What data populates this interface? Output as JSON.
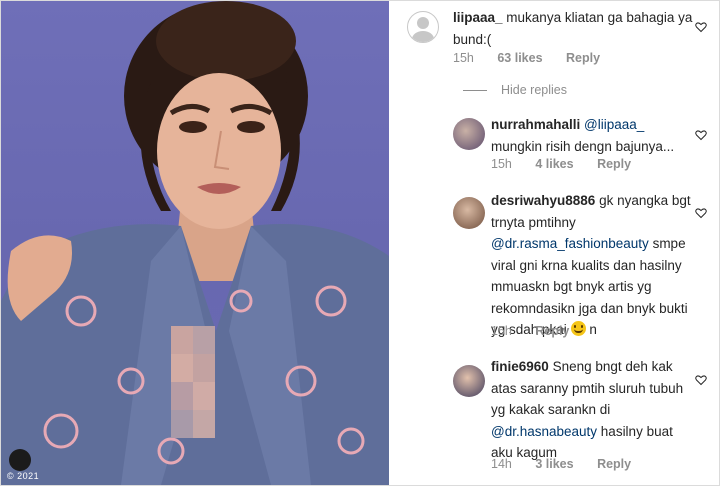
{
  "photo": {
    "watermark": "© 2021"
  },
  "comments": [
    {
      "user": "liipaaa_",
      "text": "mukanya kliatan ga bahagia ya bund:(",
      "time": "15h",
      "likes": "63 likes",
      "reply": "Reply",
      "avatar": "default-avatar-icon"
    },
    {
      "user": "nurrahmahalli",
      "mention": "@liipaaa_",
      "text": "mungkin risih dengn bajunya...",
      "time": "15h",
      "likes": "4 likes",
      "reply": "Reply"
    },
    {
      "user": "desriwahyu8886",
      "text_a": "gk nyangka bgt trnyta pmtihny",
      "mention": "@dr.rasma_fashionbeauty",
      "text_b": "smpe viral gni krna kualits dan hasilny mmuaskn bgt bnyk artis yg rekomndasikn jga dan bnyk bukti yg sdah pkai",
      "text_c": "n",
      "time": "15h",
      "reply": "Reply"
    },
    {
      "user": "finie6960",
      "text_a": "Sneng bngt deh kak atas saranny pmtih sluruh tubuh yg kakak sarankn di",
      "mention": "@dr.hasnabeauty",
      "text_b": "hasilny buat aku kagum",
      "time": "14h",
      "likes": "3 likes",
      "reply": "Reply"
    }
  ],
  "hide_replies": "Hide replies"
}
